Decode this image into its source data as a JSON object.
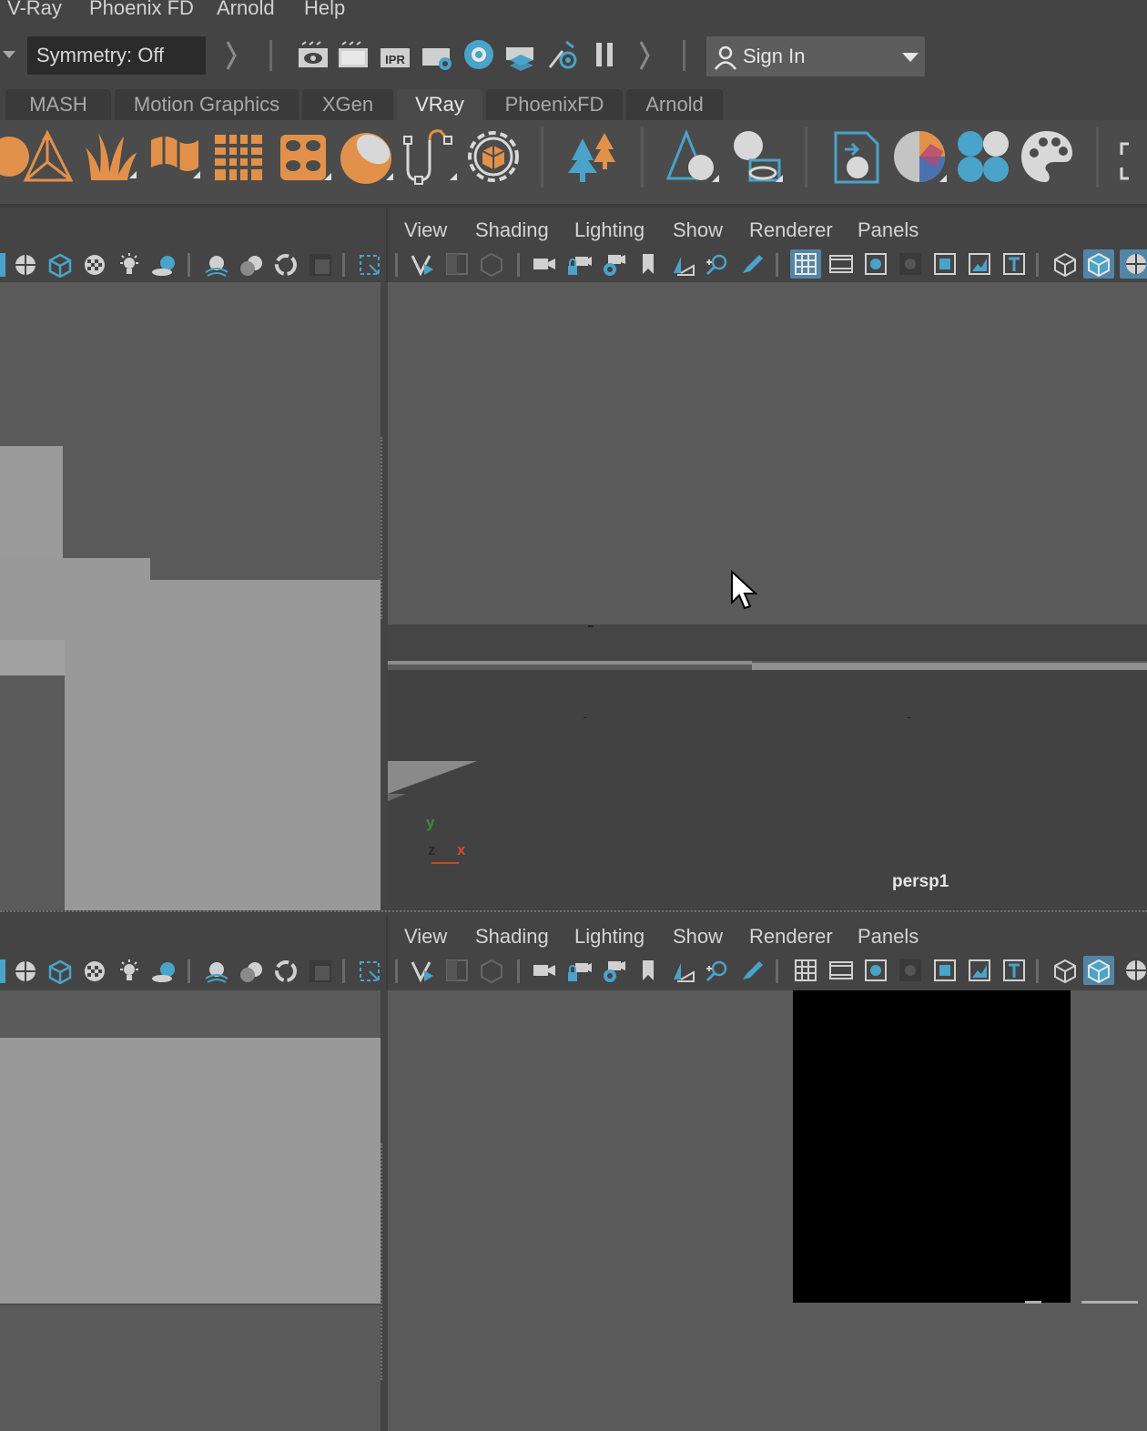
{
  "menubar": {
    "items": [
      "V-Ray",
      "Phoenix FD",
      "Arnold",
      "Help"
    ]
  },
  "status": {
    "symmetry": "Symmetry: Off",
    "signin": "Sign In"
  },
  "shelf_tabs": [
    {
      "label": "MASH",
      "active": false
    },
    {
      "label": "Motion Graphics",
      "active": false
    },
    {
      "label": "XGen",
      "active": false
    },
    {
      "label": "VRay",
      "active": true
    },
    {
      "label": "PhoenixFD",
      "active": false
    },
    {
      "label": "Arnold",
      "active": false
    }
  ],
  "shelf_icons": [
    "sphere-icon",
    "pyramid-icon",
    "fur-icon",
    "flag-icon",
    "lattice-icon",
    "proxy-icon",
    "dome-light-icon",
    "rope-icon",
    "settings-gear-icon",
    "trees-icon",
    "cone-sphere-icon",
    "shader-ball-icon",
    "import-icon",
    "material-ball-icon",
    "spheres-icon",
    "palette-icon",
    "frame-icon"
  ],
  "panel_menu": [
    "View",
    "Shading",
    "Lighting",
    "Show",
    "Renderer",
    "Panels"
  ],
  "top_viewport": {
    "camera_label": "persp1",
    "axis": {
      "y": "y",
      "z": "z",
      "x": "x"
    }
  },
  "colors": {
    "accent_blue": "#4aa3c8",
    "shelf_orange": "#e2914a",
    "ui_bg": "#444444",
    "viewport_bg": "#5a5a5a"
  }
}
